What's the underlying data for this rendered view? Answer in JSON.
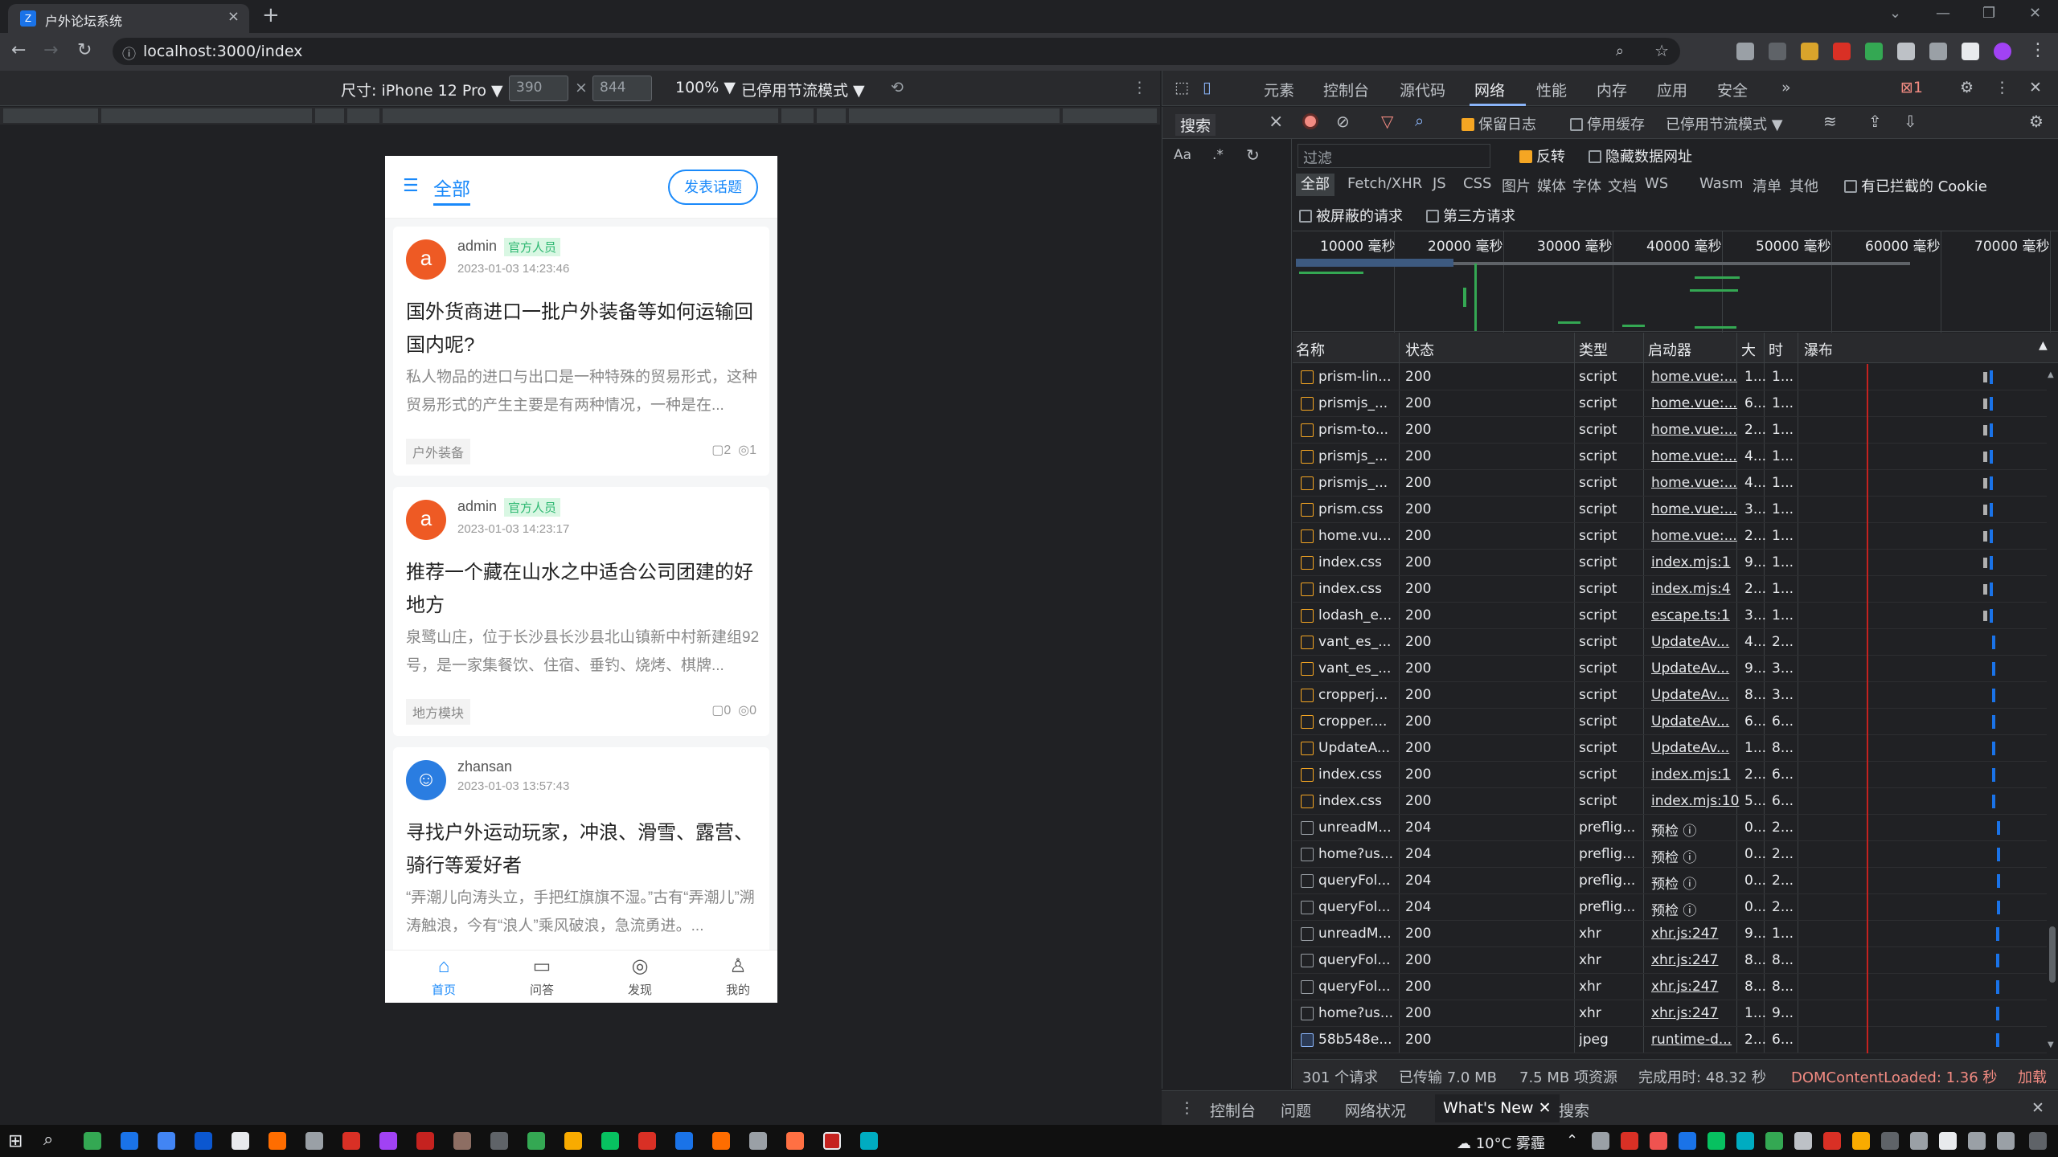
{
  "browser": {
    "tab_title": "户外论坛系统",
    "url": "localhost:3000/index",
    "tab_close": "×",
    "new_tab": "+"
  },
  "device_toolbar": {
    "device": "尺寸: iPhone 12 Pro ▼",
    "width": "390",
    "times": "×",
    "height": "844",
    "zoom": "100% ▼",
    "throttle": "已停用节流模式 ▼"
  },
  "app": {
    "header": {
      "category": "全部",
      "post_button": "发表话题"
    },
    "posts": [
      {
        "avatar": "a",
        "author": "admin",
        "badge": "官方人员",
        "date": "2023-01-03 14:23:46",
        "title": "国外货商进口一批户外装备等如何运输回国内呢?",
        "excerpt": "私人物品的进口与出口是一种特殊的贸易形式，这种贸易形式的产生主要是有两种情况，一种是在...",
        "tag": "户外装备",
        "comments": "▢2",
        "views": "◎1"
      },
      {
        "avatar": "a",
        "author": "admin",
        "badge": "官方人员",
        "date": "2023-01-03 14:23:17",
        "title": "推荐一个藏在山水之中适合公司团建的好地方",
        "excerpt": "泉鹭山庄，位于长沙县长沙县北山镇新中村新建组92号，是一家集餐饮、住宿、垂钓、烧烤、棋牌...",
        "tag": "地方模块",
        "comments": "▢0",
        "views": "◎0"
      },
      {
        "avatar": "☺",
        "author": "zhansan",
        "badge": "",
        "date": "2023-01-03 13:57:43",
        "title": "寻找户外运动玩家，冲浪、滑雪、露营、骑行等爱好者",
        "excerpt": "“弄潮儿向涛头立，手把红旗旗不湿。”古有“弄潮儿”溯涛触浪，今有“浪人”乘风破浪，急流勇进。..."
      }
    ],
    "footer": [
      {
        "icon": "⌂",
        "label": "首页"
      },
      {
        "icon": "▭",
        "label": "问答"
      },
      {
        "icon": "◎",
        "label": "发现"
      },
      {
        "icon": "♙",
        "label": "我的"
      }
    ]
  },
  "devtools": {
    "tabs": [
      "元素",
      "控制台",
      "源代码",
      "网络",
      "性能",
      "内存",
      "应用",
      "安全",
      "»"
    ],
    "error_count": "1",
    "search_panel": {
      "title": "搜索",
      "aa": "Aa",
      "regex": ".*",
      "close": "×"
    },
    "toolbar": {
      "preserve_log": "保留日志",
      "disable_cache": "停用缓存",
      "throttle": "已停用节流模式"
    },
    "filter": {
      "placeholder": "过滤",
      "invert": "反转",
      "hide_data_urls": "隐藏数据网址"
    },
    "type_filters": [
      "全部",
      "Fetch/XHR",
      "JS",
      "CSS",
      "图片",
      "媒体",
      "字体",
      "文档",
      "WS",
      "Wasm",
      "清单",
      "其他"
    ],
    "blocked_cookies": "有已拦截的 Cookie",
    "blocked_requests": "被屏蔽的请求",
    "third_party": "第三方请求",
    "timeline_ticks": [
      "10000 毫秒",
      "20000 毫秒",
      "30000 毫秒",
      "40000 毫秒",
      "50000 毫秒",
      "60000 毫秒",
      "70000 毫秒"
    ],
    "columns": [
      "名称",
      "状态",
      "类型",
      "启动器",
      "大",
      "时",
      "瀑布"
    ],
    "rows": [
      {
        "name": "prism-lin...",
        "status": "200",
        "type": "script",
        "initiator": "home.vue:...",
        "size": "1...",
        "time": "1...",
        "icon": "doc",
        "wf": 0.77,
        "long": true
      },
      {
        "name": "prismjs_...",
        "status": "200",
        "type": "script",
        "initiator": "home.vue:...",
        "size": "6...",
        "time": "1...",
        "icon": "doc",
        "wf": 0.77,
        "long": true
      },
      {
        "name": "prism-to...",
        "status": "200",
        "type": "script",
        "initiator": "home.vue:...",
        "size": "2...",
        "time": "1...",
        "icon": "doc",
        "wf": 0.77,
        "long": true
      },
      {
        "name": "prismjs_...",
        "status": "200",
        "type": "script",
        "initiator": "home.vue:...",
        "size": "4...",
        "time": "1...",
        "icon": "doc",
        "wf": 0.77,
        "long": true
      },
      {
        "name": "prismjs_...",
        "status": "200",
        "type": "script",
        "initiator": "home.vue:...",
        "size": "4...",
        "time": "1...",
        "icon": "doc",
        "wf": 0.77,
        "long": true
      },
      {
        "name": "prism.css",
        "status": "200",
        "type": "script",
        "initiator": "home.vue:...",
        "size": "3...",
        "time": "1...",
        "icon": "doc",
        "wf": 0.77,
        "long": true
      },
      {
        "name": "home.vu...",
        "status": "200",
        "type": "script",
        "initiator": "home.vue:...",
        "size": "2...",
        "time": "1...",
        "icon": "doc",
        "wf": 0.77,
        "long": true
      },
      {
        "name": "index.css",
        "status": "200",
        "type": "script",
        "initiator": "index.mjs:1",
        "size": "9...",
        "time": "1...",
        "icon": "doc",
        "wf": 0.77,
        "long": true
      },
      {
        "name": "index.css",
        "status": "200",
        "type": "script",
        "initiator": "index.mjs:4",
        "size": "2...",
        "time": "1...",
        "icon": "doc",
        "wf": 0.77,
        "long": true
      },
      {
        "name": "lodash_e...",
        "status": "200",
        "type": "script",
        "initiator": "escape.ts:1",
        "size": "3...",
        "time": "1...",
        "icon": "doc",
        "wf": 0.77,
        "long": true
      },
      {
        "name": "vant_es_...",
        "status": "200",
        "type": "script",
        "initiator": "UpdateAv...",
        "size": "4...",
        "time": "2...",
        "icon": "doc",
        "wf": 0.78,
        "long": false
      },
      {
        "name": "vant_es_...",
        "status": "200",
        "type": "script",
        "initiator": "UpdateAv...",
        "size": "9...",
        "time": "3...",
        "icon": "doc",
        "wf": 0.78,
        "long": false
      },
      {
        "name": "cropperj...",
        "status": "200",
        "type": "script",
        "initiator": "UpdateAv...",
        "size": "8...",
        "time": "3...",
        "icon": "doc",
        "wf": 0.78,
        "long": false
      },
      {
        "name": "cropper....",
        "status": "200",
        "type": "script",
        "initiator": "UpdateAv...",
        "size": "6...",
        "time": "6...",
        "icon": "doc",
        "wf": 0.78,
        "long": false
      },
      {
        "name": "UpdateA...",
        "status": "200",
        "type": "script",
        "initiator": "UpdateAv...",
        "size": "1...",
        "time": "8...",
        "icon": "doc",
        "wf": 0.78,
        "long": false
      },
      {
        "name": "index.css",
        "status": "200",
        "type": "script",
        "initiator": "index.mjs:1",
        "size": "2...",
        "time": "6...",
        "icon": "doc",
        "wf": 0.78,
        "long": false
      },
      {
        "name": "index.css",
        "status": "200",
        "type": "script",
        "initiator": "index.mjs:10",
        "size": "5...",
        "time": "6...",
        "icon": "doc",
        "wf": 0.78,
        "long": false
      },
      {
        "name": "unreadM...",
        "status": "204",
        "type": "preflig...",
        "initiator": "预检 ⓘ",
        "size": "0...",
        "time": "2...",
        "icon": "plain",
        "wf": 0.8,
        "long": false
      },
      {
        "name": "home?us...",
        "status": "204",
        "type": "preflig...",
        "initiator": "预检 ⓘ",
        "size": "0...",
        "time": "2...",
        "icon": "plain",
        "wf": 0.8,
        "long": false
      },
      {
        "name": "queryFol...",
        "status": "204",
        "type": "preflig...",
        "initiator": "预检 ⓘ",
        "size": "0...",
        "time": "2...",
        "icon": "plain",
        "wf": 0.8,
        "long": false
      },
      {
        "name": "queryFol...",
        "status": "204",
        "type": "preflig...",
        "initiator": "预检 ⓘ",
        "size": "0...",
        "time": "2...",
        "icon": "plain",
        "wf": 0.8,
        "long": false
      },
      {
        "name": "unreadM...",
        "status": "200",
        "type": "xhr",
        "initiator": "xhr.js:247",
        "size": "9...",
        "time": "1...",
        "icon": "plain",
        "wf": 0.795,
        "long": false
      },
      {
        "name": "queryFol...",
        "status": "200",
        "type": "xhr",
        "initiator": "xhr.js:247",
        "size": "8...",
        "time": "8...",
        "icon": "plain",
        "wf": 0.795,
        "long": false
      },
      {
        "name": "queryFol...",
        "status": "200",
        "type": "xhr",
        "initiator": "xhr.js:247",
        "size": "8...",
        "time": "8...",
        "icon": "plain",
        "wf": 0.795,
        "long": false
      },
      {
        "name": "home?us...",
        "status": "200",
        "type": "xhr",
        "initiator": "xhr.js:247",
        "size": "1...",
        "time": "9...",
        "icon": "plain",
        "wf": 0.795,
        "long": false
      },
      {
        "name": "58b548e...",
        "status": "200",
        "type": "jpeg",
        "initiator": "runtime-d...",
        "size": "2...",
        "time": "6...",
        "icon": "img",
        "wf": 0.795,
        "long": false
      }
    ],
    "status_bar": {
      "requests": "301 个请求",
      "transferred": "已传输 7.0 MB",
      "resources": "7.5 MB 项资源",
      "finish": "完成用时: 48.32 秒",
      "dcl": "DOMContentLoaded: 1.36 秒",
      "load": "加载"
    },
    "drawer_tabs": [
      "控制台",
      "问题",
      "网络状况",
      "What's New",
      "搜索"
    ]
  },
  "taskbar": {
    "weather": "10°C 雾霾"
  }
}
